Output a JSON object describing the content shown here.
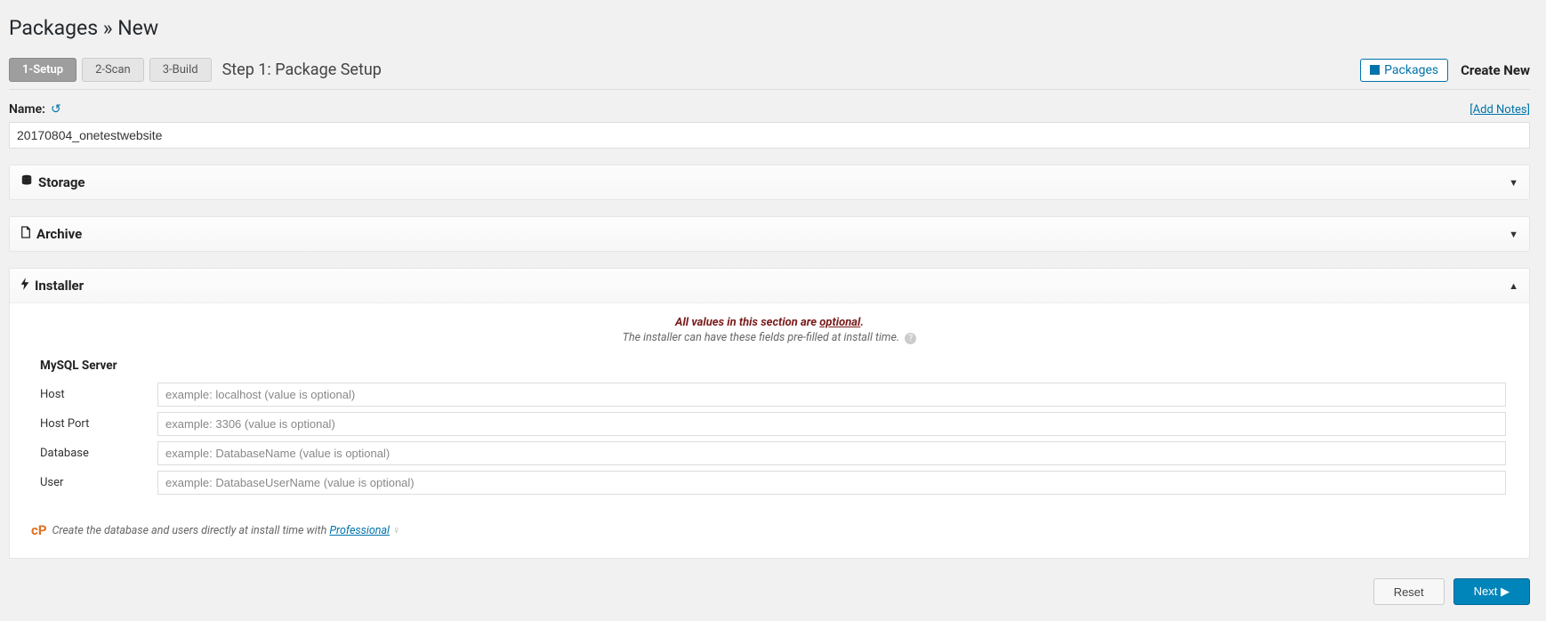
{
  "page": {
    "title": "Packages » New"
  },
  "toolbar": {
    "steps": [
      {
        "label": "1-Setup",
        "active": true
      },
      {
        "label": "2-Scan",
        "active": false
      },
      {
        "label": "3-Build",
        "active": false
      }
    ],
    "step_title": "Step 1: Package Setup",
    "packages_button": "Packages",
    "create_new": "Create New"
  },
  "name_section": {
    "label": "Name:",
    "add_notes": "[Add Notes]",
    "value": "20170804_onetestwebsite"
  },
  "panels": {
    "storage": {
      "title": "Storage"
    },
    "archive": {
      "title": "Archive"
    },
    "installer": {
      "title": "Installer",
      "notice_prefix": "All values in this section are ",
      "notice_optional": "optional",
      "notice_suffix": ".",
      "notice_sub": "The installer can have these fields pre-filled at install time.",
      "mysql_title": "MySQL Server",
      "fields": {
        "host": {
          "label": "Host",
          "placeholder": "example: localhost (value is optional)"
        },
        "host_port": {
          "label": "Host Port",
          "placeholder": "example: 3306 (value is optional)"
        },
        "database": {
          "label": "Database",
          "placeholder": "example: DatabaseName (value is optional)"
        },
        "user": {
          "label": "User",
          "placeholder": "example: DatabaseUserName (value is optional)"
        }
      },
      "footer_text": "Create the database and users directly at install time with ",
      "footer_link": "Professional"
    }
  },
  "actions": {
    "reset": "Reset",
    "next": "Next ▶"
  }
}
